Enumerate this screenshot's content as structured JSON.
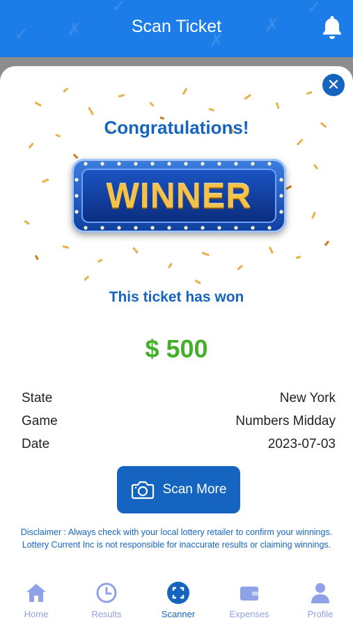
{
  "header": {
    "title": "Scan Ticket"
  },
  "result": {
    "headline": "Congratulations!",
    "badge_text": "WINNER",
    "message": "This ticket has won",
    "amount": "$ 500"
  },
  "details": [
    {
      "label": "State",
      "value": "New York"
    },
    {
      "label": "Game",
      "value": "Numbers Midday"
    },
    {
      "label": "Date",
      "value": "2023-07-03"
    }
  ],
  "actions": {
    "scan_more_label": "Scan More"
  },
  "disclaimer": "Disclaimer : Always check with your local lottery retailer to confirm your winnings. Lottery Current Inc is not responsible for inaccurate results or claiming winnings.",
  "nav": [
    {
      "label": "Home",
      "icon": "home-icon"
    },
    {
      "label": "Results",
      "icon": "clock-icon"
    },
    {
      "label": "Scanner",
      "icon": "scanner-icon",
      "active": true
    },
    {
      "label": "Expenses",
      "icon": "wallet-icon"
    },
    {
      "label": "Profile",
      "icon": "person-icon"
    }
  ],
  "colors": {
    "primary": "#1565c0",
    "header": "#1d7de8",
    "amount": "#43b02a",
    "nav_inactive": "#8fa2e8"
  }
}
